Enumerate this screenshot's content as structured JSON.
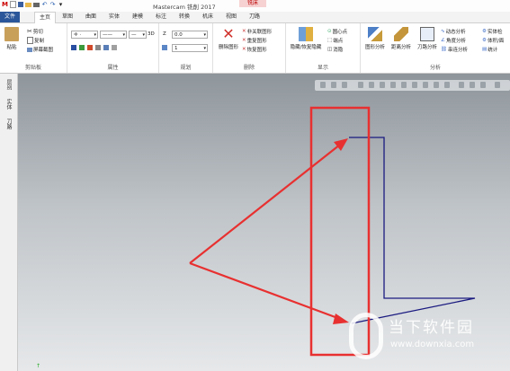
{
  "app": {
    "title": "Mastercam 铣削 2017",
    "context_tab_title": "铣床"
  },
  "tabs": [
    "文件",
    "主页",
    "草图",
    "曲面",
    "实体",
    "建模",
    "标注",
    "转换",
    "机床",
    "视图",
    "刀路"
  ],
  "ribbon": {
    "clipboard": {
      "label": "剪贴板",
      "paste": "粘贴",
      "cut": "剪切",
      "copy": "复制",
      "screenshot": "屏幕截图"
    },
    "properties": {
      "label": "属性",
      "dim_3d": "3D"
    },
    "planes": {
      "label": "规划",
      "z_label": "Z",
      "z_value": "0.0",
      "level_value": "1"
    },
    "delete": {
      "label": "删除",
      "delete_entity": "删除图形",
      "non_assoc": "非关联图形",
      "repeat": "重复图形",
      "restore": "恢复图形"
    },
    "display": {
      "label": "显示",
      "hide_unhide": "隐藏/恢复隐藏",
      "arc_center": "圆心点",
      "endpoint": "端点",
      "edge": "消隐"
    },
    "analyze": {
      "label": "分析",
      "entity_analysis": "图形分析",
      "distance_analysis": "距离分析",
      "toolpath_analysis": "刀路分析",
      "dynamic_analysis": "动态分析",
      "angle_analysis": "角度分析",
      "chain_analysis": "串连分析",
      "solid_check": "实体检",
      "volume_area": "体积/面",
      "statistics": "统计"
    }
  },
  "sidebar": {
    "tabs": [
      "层别",
      "实体",
      "刀路"
    ]
  },
  "watermark": {
    "text": "当下软件园",
    "url": "www.downxia.com"
  },
  "colors": {
    "file_tab": "#2b579a",
    "geometry": "#1a1a80",
    "annotation": "#e83030",
    "context_tab": "#f6d2d2"
  }
}
